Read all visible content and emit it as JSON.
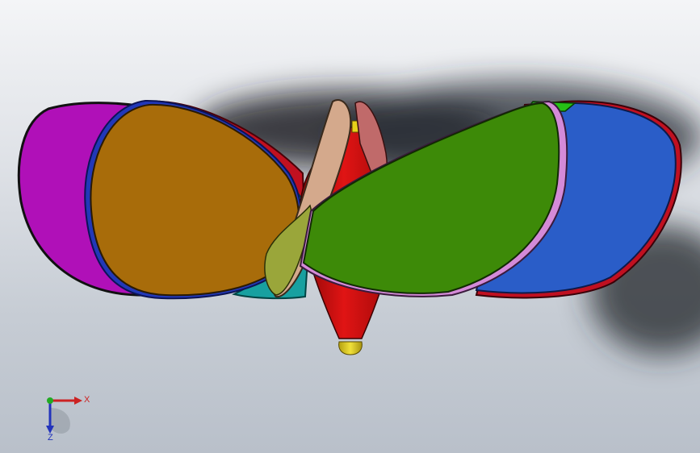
{
  "viewport": {
    "background_top": "#f4f5f7",
    "background_bottom": "#b9c0ca",
    "model": {
      "name": "propeller",
      "blade_count": 4,
      "colors": {
        "hub": "#cc1010",
        "hub_tip": "#e8d21a",
        "blade_left_back": "#b010b8",
        "blade_left_front": "#a86c0a",
        "blade_right_back": "#2a5dc8",
        "blade_right_front": "#3d8a08",
        "blade_center": "#9aa63a",
        "blade_center_edge": "#d4a98c",
        "blade_center_back": "#c06a6a",
        "teal_edge": "#18a0a0",
        "red_edge": "#c01020"
      }
    },
    "triad": {
      "x_label": "X",
      "z_label": "Z",
      "x_color": "#cc2222",
      "y_color": "#22aa22",
      "z_color": "#2233bb"
    }
  }
}
